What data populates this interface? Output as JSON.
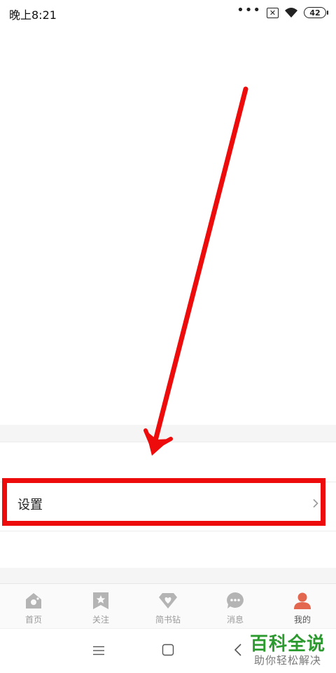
{
  "status_bar": {
    "time": "晚上8:21",
    "more_dots": "•••",
    "sim_mark": "✕",
    "battery": "42"
  },
  "settings": {
    "label": "设置"
  },
  "tabs": [
    {
      "label": "首页",
      "icon": "home-icon"
    },
    {
      "label": "关注",
      "icon": "bookmark-star-icon"
    },
    {
      "label": "简书钻",
      "icon": "diamond-heart-icon"
    },
    {
      "label": "消息",
      "icon": "chat-bubble-icon"
    },
    {
      "label": "我的",
      "icon": "profile-icon"
    }
  ],
  "active_tab": "我的",
  "watermark": {
    "title": "百科全说",
    "subtitle": "助你轻松解决"
  },
  "colors": {
    "annotation_red": "#ee0b0b",
    "active_tab_accent": "#e2674e",
    "inactive_icon": "#b4b4b4",
    "watermark_green": "#2c9a2f"
  }
}
